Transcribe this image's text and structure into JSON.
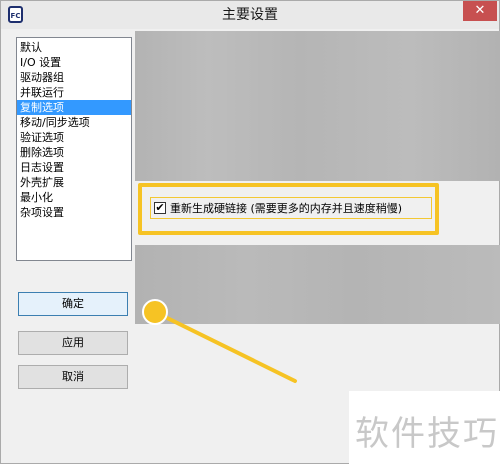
{
  "window": {
    "title": "主要设置",
    "app_icon_text": "FC",
    "close_label": "✕"
  },
  "sidebar": {
    "items": [
      {
        "label": "默认",
        "selected": false
      },
      {
        "label": "I/O 设置",
        "selected": false
      },
      {
        "label": "驱动器组",
        "selected": false
      },
      {
        "label": "并联运行",
        "selected": false
      },
      {
        "label": "复制选项",
        "selected": true
      },
      {
        "label": "移动/同步选项",
        "selected": false
      },
      {
        "label": "验证选项",
        "selected": false
      },
      {
        "label": "删除选项",
        "selected": false
      },
      {
        "label": "日志设置",
        "selected": false
      },
      {
        "label": "外壳扩展",
        "selected": false
      },
      {
        "label": "最小化",
        "selected": false
      },
      {
        "label": "杂项设置",
        "selected": false
      }
    ]
  },
  "option": {
    "checked_mark": "✔",
    "label": "重新生成硬链接 (需要更多的内存并且速度稍慢)"
  },
  "buttons": {
    "ok": "确定",
    "apply": "应用",
    "cancel": "取消"
  },
  "watermark": "软件技巧",
  "colors": {
    "highlight": "#f6c324",
    "selected": "#3399ff",
    "close": "#c75050"
  }
}
